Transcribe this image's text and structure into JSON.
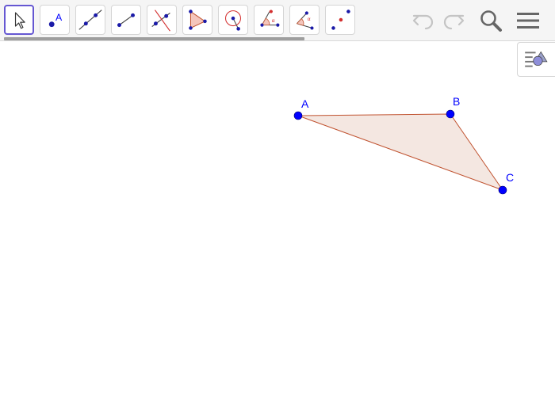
{
  "toolbar": {
    "tools": [
      {
        "name": "move-tool",
        "icon": "cursor-arrow-icon",
        "selected": true
      },
      {
        "name": "point-tool",
        "icon": "point-icon",
        "label": "A"
      },
      {
        "name": "line-tool",
        "icon": "line-through-points-icon"
      },
      {
        "name": "segment-tool",
        "icon": "segment-icon"
      },
      {
        "name": "perpendicular-line-tool",
        "icon": "perpendicular-line-icon"
      },
      {
        "name": "polygon-tool",
        "icon": "polygon-icon"
      },
      {
        "name": "circle-tool",
        "icon": "circle-center-point-icon"
      },
      {
        "name": "angle-tool",
        "icon": "angle-icon",
        "label": "α"
      },
      {
        "name": "angle-given-size-tool",
        "icon": "angle-given-size-icon",
        "label": "α"
      },
      {
        "name": "reflect-tool",
        "icon": "reflect-about-point-icon"
      }
    ],
    "actions": [
      {
        "name": "undo-button",
        "icon": "undo-icon"
      },
      {
        "name": "redo-button",
        "icon": "redo-icon"
      },
      {
        "name": "search-button",
        "icon": "search-icon"
      },
      {
        "name": "menu-button",
        "icon": "hamburger-menu-icon"
      }
    ]
  },
  "algebra_toggle": {
    "icon": "algebra-view-toggle-icon"
  },
  "colors": {
    "accent": "#6557d2",
    "point": "#0000ff",
    "label": "#0000ff",
    "polygon_fill": "#f4e7e1",
    "polygon_stroke": "#c0522f",
    "tool_red": "#d32f2f"
  },
  "construction": {
    "points": [
      {
        "label": "A"
      },
      {
        "label": "B"
      },
      {
        "label": "C"
      }
    ],
    "polygon": {
      "vertices": [
        "A",
        "B",
        "C"
      ]
    }
  }
}
